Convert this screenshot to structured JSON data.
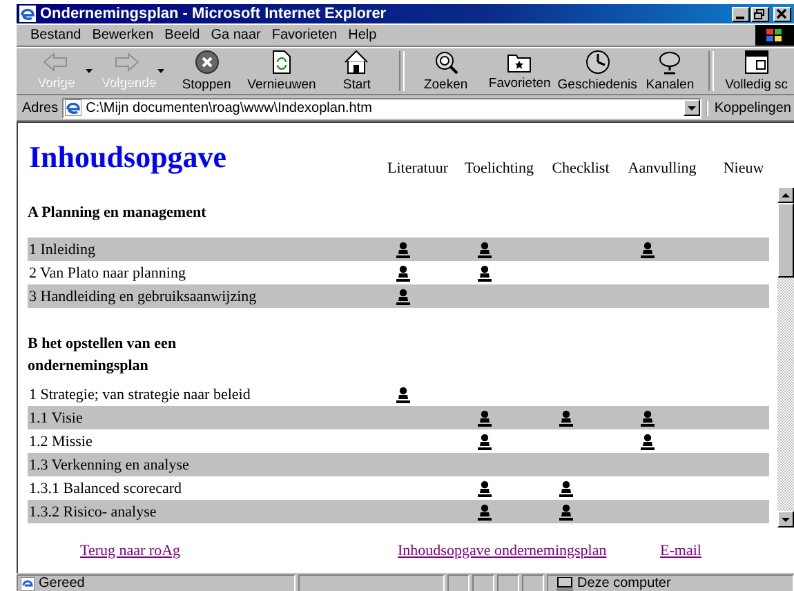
{
  "window": {
    "title": "Ondernemingsplan - Microsoft Internet Explorer"
  },
  "menu": [
    "Bestand",
    "Bewerken",
    "Beeld",
    "Ga naar",
    "Favorieten",
    "Help"
  ],
  "toolbar": [
    {
      "kind": "back",
      "label": "Vorige",
      "disabled": true,
      "dropdown": true
    },
    {
      "kind": "forward",
      "label": "Volgende",
      "disabled": true,
      "dropdown": true
    },
    {
      "kind": "stop",
      "label": "Stoppen",
      "disabled": false,
      "dropdown": false
    },
    {
      "kind": "refresh",
      "label": "Vernieuwen",
      "disabled": false,
      "dropdown": false
    },
    {
      "kind": "home",
      "label": "Start",
      "disabled": false,
      "dropdown": false
    },
    {
      "kind": "search",
      "label": "Zoeken",
      "disabled": false,
      "dropdown": false
    },
    {
      "kind": "favorites",
      "label": "Favorieten",
      "disabled": false,
      "dropdown": false
    },
    {
      "kind": "history",
      "label": "Geschiedenis",
      "disabled": false,
      "dropdown": false
    },
    {
      "kind": "channels",
      "label": "Kanalen",
      "disabled": false,
      "dropdown": false
    },
    {
      "kind": "fullscreen",
      "label": "Volledig sc",
      "disabled": false,
      "dropdown": false
    }
  ],
  "address": {
    "label": "Adres",
    "value": "C:\\Mijn documenten\\roag\\www\\Indexoplan.htm",
    "links": "Koppelingen"
  },
  "page": {
    "title": "Inhoudsopgave",
    "columns": [
      "Literatuur",
      "Toelichting",
      "Checklist",
      "Aanvulling",
      "Nieuw"
    ],
    "sections": [
      {
        "heading": "A Planning en management",
        "rows": [
          {
            "label": "1 Inleiding",
            "shaded": true,
            "marks": [
              true,
              true,
              false,
              true,
              false
            ]
          },
          {
            "label": "2 Van Plato naar planning",
            "shaded": false,
            "marks": [
              true,
              true,
              false,
              false,
              false
            ]
          },
          {
            "label": "3 Handleiding en gebruiksaanwijzing",
            "shaded": true,
            "marks": [
              true,
              false,
              false,
              false,
              false
            ]
          }
        ]
      },
      {
        "heading": "B het opstellen van een ondernemingsplan",
        "rows": [
          {
            "label": "1 Strategie; van strategie naar beleid",
            "shaded": false,
            "marks": [
              true,
              false,
              false,
              false,
              false
            ]
          },
          {
            "label": "1.1 Visie",
            "shaded": true,
            "marks": [
              false,
              true,
              true,
              true,
              false
            ]
          },
          {
            "label": "1.2 Missie",
            "shaded": false,
            "marks": [
              false,
              true,
              false,
              true,
              false
            ]
          },
          {
            "label": "1.3 Verkenning en analyse",
            "shaded": true,
            "marks": [
              false,
              false,
              false,
              false,
              false
            ]
          },
          {
            "label": "1.3.1 Balanced scorecard",
            "shaded": false,
            "marks": [
              false,
              true,
              true,
              false,
              false
            ]
          },
          {
            "label": "1.3.2 Risico- analyse",
            "shaded": true,
            "marks": [
              false,
              true,
              true,
              false,
              false
            ]
          }
        ]
      }
    ]
  },
  "footer_links": [
    "Terug naar roAg",
    "Inhoudsopgave ondernemingsplan",
    "E-mail"
  ],
  "status": {
    "text": "Gereed",
    "zone": "Deze computer"
  }
}
